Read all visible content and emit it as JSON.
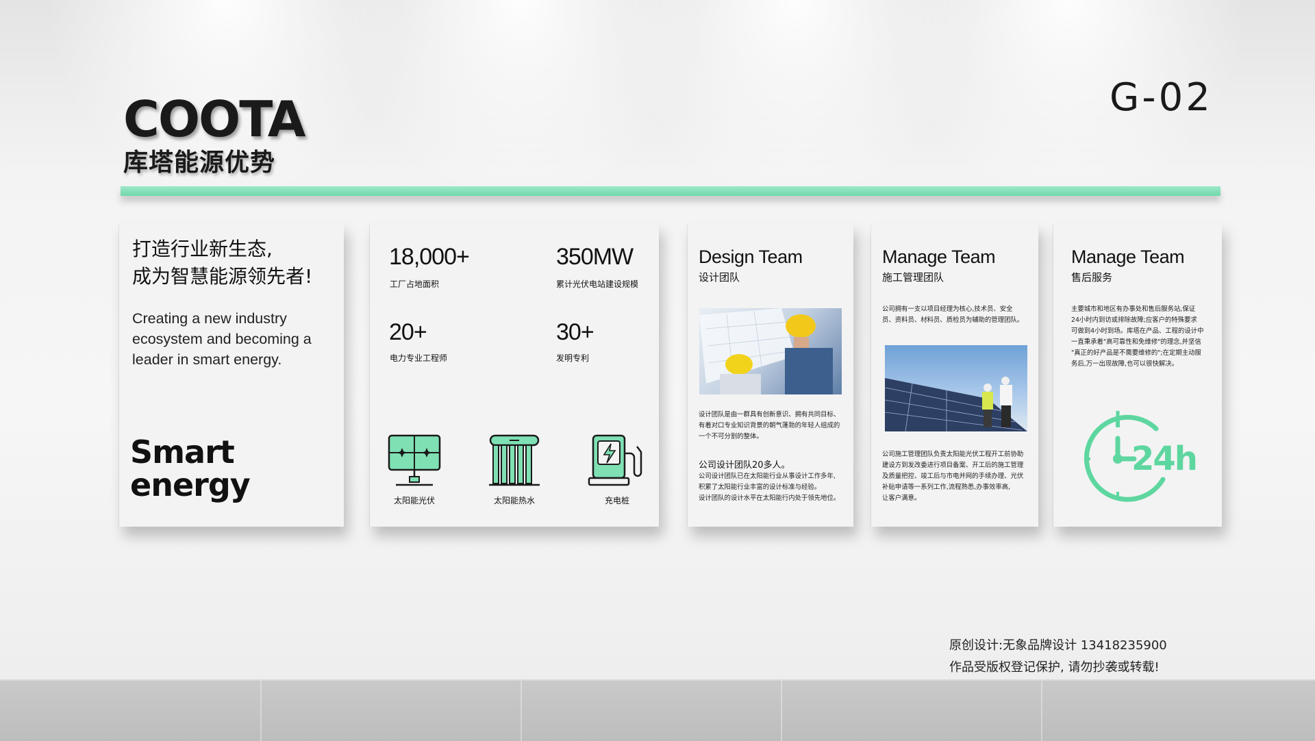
{
  "brand": {
    "logo": "COOTA",
    "subtitle": "库塔能源优势",
    "code": "G-02",
    "accent": "#6fd8aa"
  },
  "panel1": {
    "cn_line1": "打造行业新生态,",
    "cn_line2": "成为智慧能源领先者!",
    "en_line1": "Creating a new industry",
    "en_line2": "ecosystem and becoming a",
    "en_line3": "leader in smart energy.",
    "smart_line1": "Smart",
    "smart_line2": "energy"
  },
  "panel2": {
    "stats": [
      {
        "value": "18,000+",
        "label": "工厂占地面积"
      },
      {
        "value": "350MW",
        "label": "累计光伏电站建设规模"
      },
      {
        "value": "20+",
        "label": "电力专业工程师"
      },
      {
        "value": "30+",
        "label": "发明专利"
      }
    ],
    "icons": [
      {
        "label": "太阳能光伏",
        "icon": "solar-panel-icon"
      },
      {
        "label": "太阳能热水",
        "icon": "solar-water-heater-icon"
      },
      {
        "label": "充电桩",
        "icon": "charging-pile-icon"
      }
    ]
  },
  "panel3": {
    "title_en": "Design Team",
    "title_cn": "设计团队",
    "desc": [
      "设计团队是由一群具有创新意识、拥有共同目标、",
      "有着对口专业知识背景的朝气蓬勃的年轻人组成的",
      "一个不可分割的整体。"
    ],
    "sub_title": "公司设计团队20多人。",
    "sub_desc": [
      "公司设计团队已在太阳能行业从事设计工作多年,",
      "积累了太阳能行业丰富的设计标准与经验。",
      "设计团队的设计水平在太阳能行内处于领先地位。"
    ]
  },
  "panel4": {
    "title_en": "Manage Team",
    "title_cn": "施工管理团队",
    "desc": [
      "公司拥有一支以项目经理为核心,技术员、安全",
      "员、资料员、材料员、质检员为辅助的管理团队。"
    ],
    "desc2": [
      "公司施工管理团队负责太阳能光伏工程开工前协助",
      "建设方到发改委进行项目备案、开工后的施工管理",
      "及质量把控、竣工后与市电并网的手续办理、光伏",
      "补贴申请等一系列工作,流程熟悉,办事效率高,",
      "让客户满意。"
    ]
  },
  "panel5": {
    "title_en": "Manage Team",
    "title_cn": "售后服务",
    "desc": [
      "主要城市和地区有办事处和售后服务站,保证",
      "24小时内到访或排除故障;应客户的特殊要求",
      "可做到4小时到场。库塔在产品、工程的设计中",
      "一直秉承着\"高可靠性和免维修\"的理念,并坚信",
      "\"真正的好产品是不需要维修的\";在定期主动服",
      "务后,万一出现故障,也可以很快解决。"
    ],
    "badge": "24h"
  },
  "credit": {
    "line1": "原创设计:无象品牌设计 13418235900",
    "line2": "作品受版权登记保护, 请勿抄袭或转载!"
  }
}
